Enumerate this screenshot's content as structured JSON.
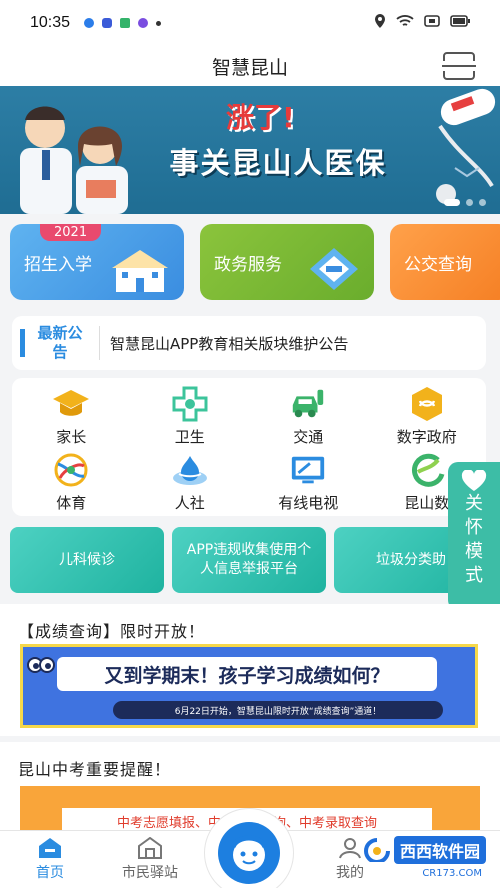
{
  "status_bar": {
    "time": "10:35"
  },
  "header": {
    "title": "智慧昆山",
    "scan_icon": "scan-icon"
  },
  "banner": {
    "tag": "涨了!",
    "headline": "事关昆山人医保"
  },
  "quick_cards": [
    {
      "year": "2021",
      "label": "招生入学",
      "color": "#3a8de0"
    },
    {
      "label": "政务服务",
      "color": "#6aad2d"
    },
    {
      "label": "公交查询",
      "color": "#f57f24"
    }
  ],
  "notice": {
    "tag": "最新公告",
    "text": "智慧昆山APP教育相关版块维护公告"
  },
  "services": [
    {
      "label": "家长",
      "icon": "graduation-cap-icon"
    },
    {
      "label": "卫生",
      "icon": "medical-cross-icon"
    },
    {
      "label": "交通",
      "icon": "car-icon"
    },
    {
      "label": "数字政府",
      "icon": "government-icon"
    },
    {
      "label": "体育",
      "icon": "sports-icon"
    },
    {
      "label": "人社",
      "icon": "social-icon"
    },
    {
      "label": "有线电视",
      "icon": "tv-icon"
    },
    {
      "label": "昆山数",
      "icon": "data-icon"
    }
  ],
  "care_mode": {
    "label": "关怀模式"
  },
  "features": [
    {
      "label": "儿科候诊"
    },
    {
      "label": "APP违规收集使用个人信息举报平台"
    },
    {
      "label": "垃圾分类助"
    }
  ],
  "score_section": {
    "title": "【成绩查询】限时开放！",
    "headline": "又到学期末！孩子学习成绩如何？",
    "sub": "6月22日开始，智慧昆山限时开放“成绩查询”通道！"
  },
  "exam_section": {
    "title": "昆山中考重要提醒！",
    "banner_text": "中考志愿填报、中考成绩查询、中考录取查询"
  },
  "tabbar": {
    "home": "首页",
    "station": "市民驿站",
    "mine": "我的"
  },
  "watermark": {
    "text": "西西软件园",
    "sub": "CR173.COM"
  }
}
